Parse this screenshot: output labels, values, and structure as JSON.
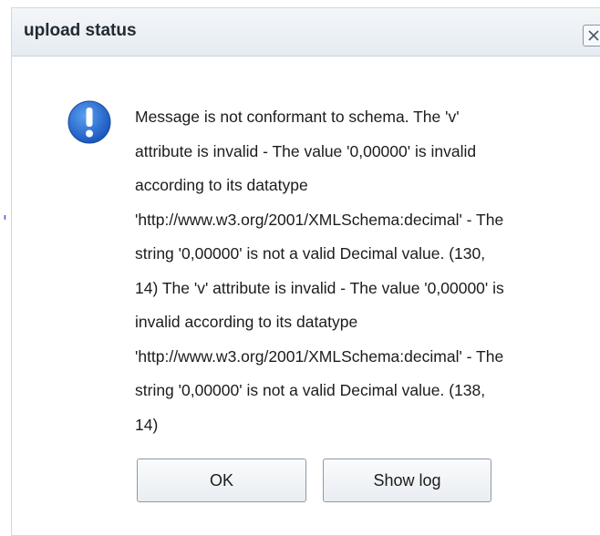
{
  "dialog": {
    "title": "upload status",
    "message_lines": [
      "Message is not conformant to schema. The 'v'",
      "attribute is invalid - The value '0,00000' is invalid",
      "according to its datatype",
      "'http://www.w3.org/2001/XMLSchema:decimal' - The",
      "string '0,00000' is not a valid Decimal value. (130,",
      "14) The 'v' attribute is invalid - The value '0,00000' is",
      "invalid according to its datatype",
      "'http://www.w3.org/2001/XMLSchema:decimal' - The",
      "string '0,00000' is not a valid Decimal value. (138,",
      "14)"
    ],
    "ok_label": "OK",
    "show_log_label": "Show log",
    "icon": "exclamation-icon",
    "accent_color": "#2b6fd1"
  },
  "background": {
    "glyph": "',"
  }
}
